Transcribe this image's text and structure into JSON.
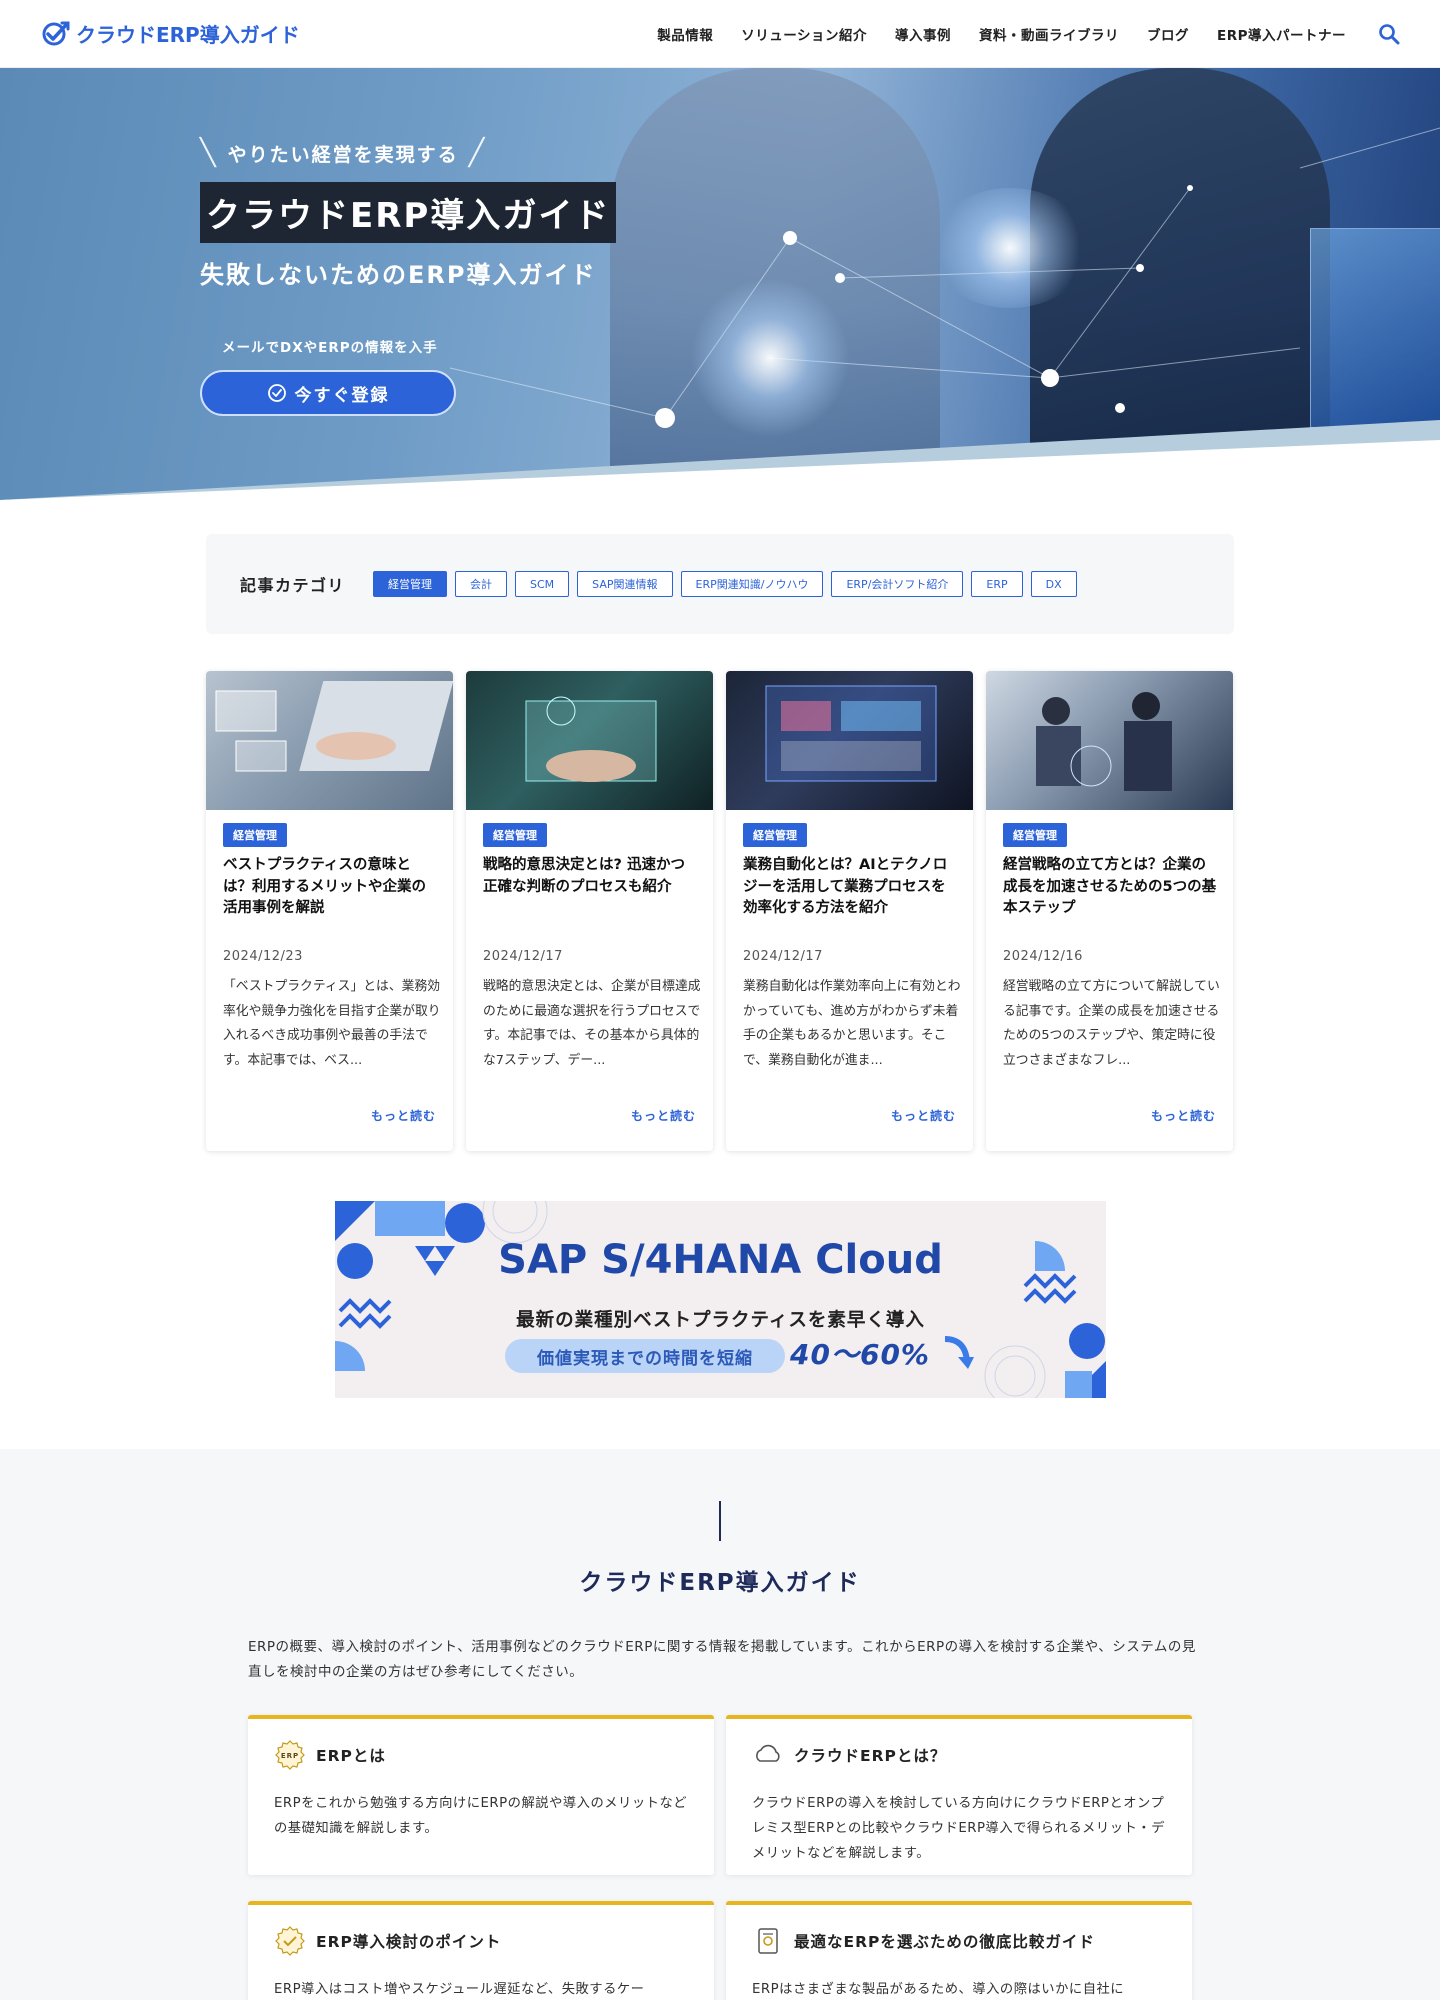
{
  "header": {
    "logo_text": "クラウドERP導入ガイド",
    "nav": [
      {
        "label": "製品情報"
      },
      {
        "label": "ソリューション紹介"
      },
      {
        "label": "導入事例"
      },
      {
        "label": "資料・動画ライブラリ"
      },
      {
        "label": "ブログ"
      },
      {
        "label": "ERP導入パートナー"
      }
    ],
    "search_icon": "search-icon"
  },
  "hero": {
    "tagline": "やりたい経営を実現する",
    "title": "クラウドERP導入ガイド",
    "subtitle": "失敗しないためのERP導入ガイド",
    "mail_text": "メールでDXやERPの情報を入手",
    "button_label": "今すぐ登録"
  },
  "categories": {
    "title": "記事カテゴリ",
    "items": [
      {
        "label": "経営管理",
        "active": true
      },
      {
        "label": "会計"
      },
      {
        "label": "SCM"
      },
      {
        "label": "SAP関連情報"
      },
      {
        "label": "ERP関連知識/ノウハウ"
      },
      {
        "label": "ERP/会計ソフト紹介"
      },
      {
        "label": "ERP"
      },
      {
        "label": "DX"
      }
    ]
  },
  "articles": [
    {
      "badge": "経営管理",
      "title": "ベストプラクティスの意味とは？利用するメリットや企業の活用事例を解説",
      "date": "2024/12/23",
      "excerpt": "「ベストプラクティス」とは、業務効率化や競争力強化を目指す企業が取り入れるべき成功事例や最善の手法です。本記事では、ベス...",
      "more": "もっと読む"
    },
    {
      "badge": "経営管理",
      "title": "戦略的意思決定とは? 迅速かつ正確な判断のプロセスも紹介",
      "date": "2024/12/17",
      "excerpt": "戦略的意思決定とは、企業が目標達成のために最適な選択を行うプロセスです。本記事では、その基本から具体的な7ステップ、デー...",
      "more": "もっと読む"
    },
    {
      "badge": "経営管理",
      "title": "業務自動化とは？AIとテクノロジーを活用して業務プロセスを効率化する方法を紹介",
      "date": "2024/12/17",
      "excerpt": "業務自動化は作業効率向上に有効とわかっていても、進め方がわからず未着手の企業もあるかと思います。そこで、業務自動化が進ま...",
      "more": "もっと読む"
    },
    {
      "badge": "経営管理",
      "title": "経営戦略の立て方とは？企業の成長を加速させるための5つの基本ステップ",
      "date": "2024/12/16",
      "excerpt": "経営戦略の立て方について解説している記事です。企業の成長を加速させるための5つのステップや、策定時に役立つさまざまなフレ...",
      "more": "もっと読む"
    }
  ],
  "banner": {
    "title": "SAP S/4HANA Cloud",
    "subtitle": "最新の業種別ベストプラクティスを素早く導入",
    "pill": "価値実現までの時間を短縮",
    "percent": "40～60%"
  },
  "guide": {
    "title": "クラウドERP導入ガイド",
    "description": "ERPの概要、導入検討のポイント、活用事例などのクラウドERPに関する情報を掲載しています。これからERPの導入を検討する企業や、システムの見直しを検討中の企業の方はぜひ参考にしてください。",
    "cards": [
      {
        "title": "ERPとは",
        "icon": "erp-badge-icon",
        "body": "ERPをこれから勉強する方向けにERPの解説や導入のメリットなどの基礎知識を解説します。"
      },
      {
        "title": "クラウドERPとは？",
        "icon": "cloud-icon",
        "body": "クラウドERPの導入を検討している方向けにクラウドERPとオンプレミス型ERPとの比較やクラウドERP導入で得られるメリット・デメリットなどを解説します。"
      },
      {
        "title": "ERP導入検討のポイント",
        "icon": "check-badge-icon",
        "body": "ERP導入はコスト増やスケジュール遅延など、失敗するケー"
      },
      {
        "title": "最適なERPを選ぶための徹底比較ガイド",
        "icon": "document-icon",
        "body": "ERPはさまざまな製品があるため、導入の際はいかに自社に"
      }
    ]
  },
  "colors": {
    "accent": "#2d63d8",
    "gold": "#e7b51e",
    "navy": "#1e2a5a"
  }
}
